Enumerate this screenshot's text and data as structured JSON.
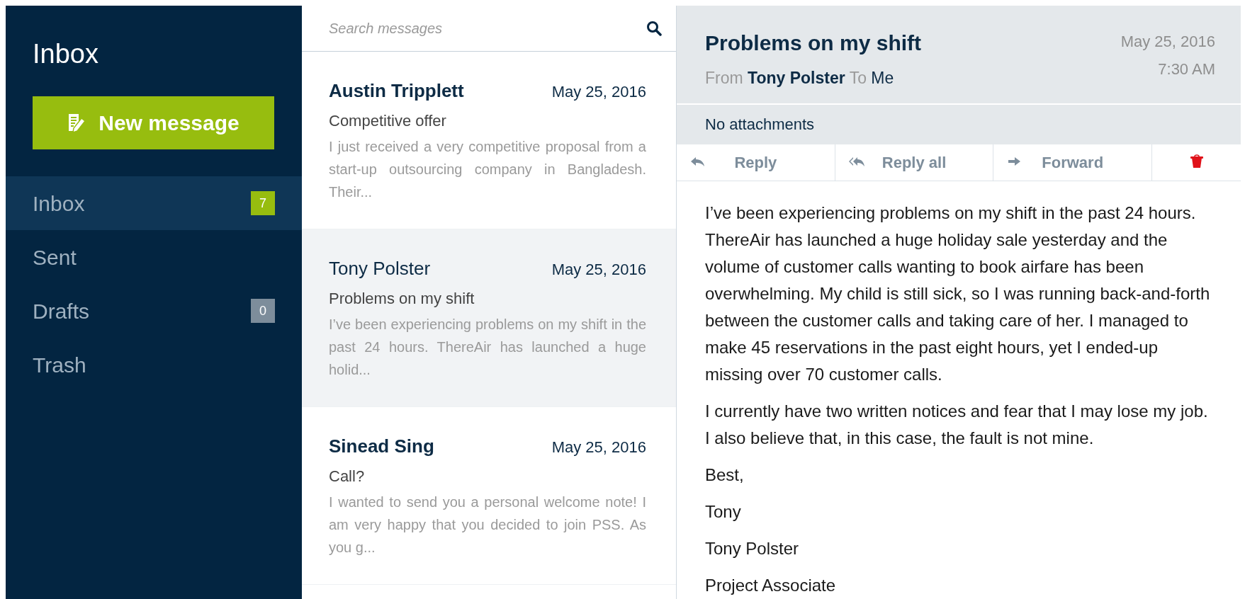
{
  "sidebar": {
    "title": "Inbox",
    "new_button": "New message",
    "items": [
      {
        "label": "Inbox",
        "selected": true,
        "badge": "7",
        "color": "#97bd0f"
      },
      {
        "label": "Sent",
        "selected": false
      },
      {
        "label": "Drafts",
        "selected": false,
        "badge": "0",
        "color": "#7d8d9b"
      },
      {
        "label": "Trash",
        "selected": false
      }
    ]
  },
  "search": {
    "placeholder": "Search messages"
  },
  "messages": [
    {
      "sender": "Austin Tripplett",
      "date": "May 25, 2016",
      "subject": "Competitive offer",
      "preview": "I just received a very competitive proposal from a start-up outsourcing company in Bangladesh. Their...",
      "unread": true,
      "selected": false
    },
    {
      "sender": "Tony Polster",
      "date": "May 25, 2016",
      "subject": "Problems on my shift",
      "preview": "I’ve been experiencing problems on my shift in the past 24 hours. ThereAir has launched a huge holid...",
      "unread": false,
      "selected": true
    },
    {
      "sender": "Sinead Sing",
      "date": "May 25, 2016",
      "subject": "Call?",
      "preview": "I wanted to send you a personal welcome note! I am very happy that you decided to join PSS. As you g...",
      "unread": true,
      "selected": false
    }
  ],
  "reader": {
    "subject": "Problems on my shift",
    "from_label": "From",
    "from": "Tony Polster",
    "to_label": "To",
    "to": "Me",
    "date": "May 25, 2016",
    "time": "7:30 AM",
    "attachments": "No attachments",
    "actions": [
      {
        "kind": "reply",
        "label": "Reply"
      },
      {
        "kind": "reply_all",
        "label": "Reply all"
      },
      {
        "kind": "forward",
        "label": "Forward"
      },
      {
        "kind": "delete"
      }
    ],
    "body": [
      "I’ve been experiencing problems on my shift in the past 24 hours. ThereAir has launched a huge holiday sale yesterday and the volume of customer calls wanting to book airfare has been overwhelming. My child is still sick, so I was running back-and-forth between the customer calls and taking care of her. I managed to make 45 reservations in the past eight hours, yet I ended-up missing over 70 customer calls.",
      "I currently have two written notices and fear that I may lose my job. I also believe that, in this case, the fault is not mine.",
      "Best,",
      "Tony",
      "Tony Polster",
      "Project Associate"
    ]
  }
}
